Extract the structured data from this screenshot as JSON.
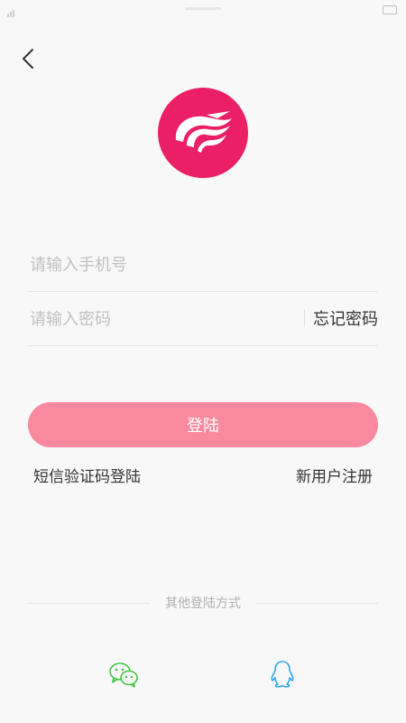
{
  "login": {
    "phone_placeholder": "请输入手机号",
    "password_placeholder": "请输入密码",
    "forgot_password": "忘记密码",
    "login_button": "登陆",
    "sms_login": "短信验证码登陆",
    "register": "新用户注册",
    "other_methods_title": "其他登陆方式"
  },
  "icons": {
    "back": "back-arrow-icon",
    "logo": "bird-logo",
    "wechat": "wechat-icon",
    "qq": "qq-icon"
  },
  "colors": {
    "brand": "#ea1f66",
    "login_button": "#f9899f",
    "wechat": "#3ec43f",
    "qq": "#2ea6ee"
  }
}
